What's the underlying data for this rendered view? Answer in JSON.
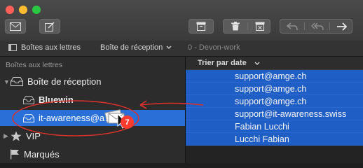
{
  "favorites_bar": {
    "mailboxes_label": "Boîtes aux lettres",
    "inbox_label": "Boîte de réception",
    "account_label": "0 - Devon-work"
  },
  "sidebar": {
    "header": "Boîtes aux lettres",
    "inbox": "Boîte de réception",
    "accounts": [
      "Bluewin",
      "it-awareness@a…h"
    ],
    "vip": "VIP",
    "flagged": "Marqués"
  },
  "drag_badge_count": "7",
  "message_list": {
    "sort_label": "Trier par date",
    "senders": [
      "support@amge.ch",
      "support@amge.ch",
      "support@amge.ch",
      "support@it-awareness.swiss",
      "Fabian Lucchi",
      "Lucchi Fabian"
    ]
  },
  "colors": {
    "selection": "#2a6fd8",
    "row_highlight": "#1f5ec4",
    "annotation": "#d9312b",
    "badge": "#ff3b30"
  }
}
